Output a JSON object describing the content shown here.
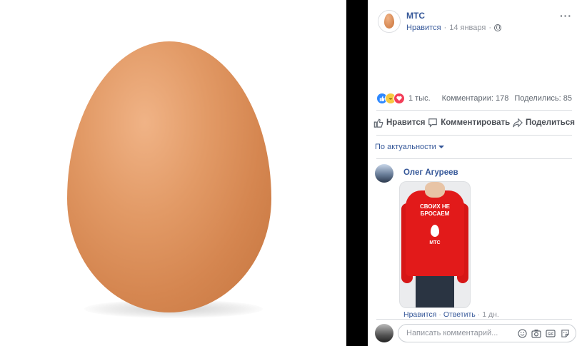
{
  "post": {
    "page_name": "МТС",
    "meta": {
      "like_link": "Нравится",
      "separator": "·",
      "date": "14 января"
    },
    "more_label": "···"
  },
  "stats": {
    "reactions_count": "1 тыс.",
    "comments": "Комментарии: 178",
    "shares": "Поделились: 85"
  },
  "actions": {
    "like": "Нравится",
    "comment": "Комментировать",
    "share": "Поделиться"
  },
  "sort": {
    "label": "По актуальности"
  },
  "comment": {
    "author": "Олег Агуреев",
    "photo_text": "СВОИХ НЕ БРОСАЕМ",
    "photo_brand": "МТС",
    "like_link": "Нравится",
    "reply_link": "Ответить",
    "separator": "·",
    "time": "1 дн."
  },
  "composer": {
    "placeholder": "Написать комментарий..."
  },
  "icons": {
    "reactions": [
      "like-reaction-icon",
      "haha-reaction-icon",
      "love-reaction-icon"
    ],
    "composer": [
      "emoji-icon",
      "camera-icon",
      "gif-icon",
      "sticker-icon"
    ]
  },
  "colors": {
    "link": "#365899",
    "like_blue": "#2d88ff",
    "love_red": "#f33e58",
    "egg": "#d58650"
  }
}
